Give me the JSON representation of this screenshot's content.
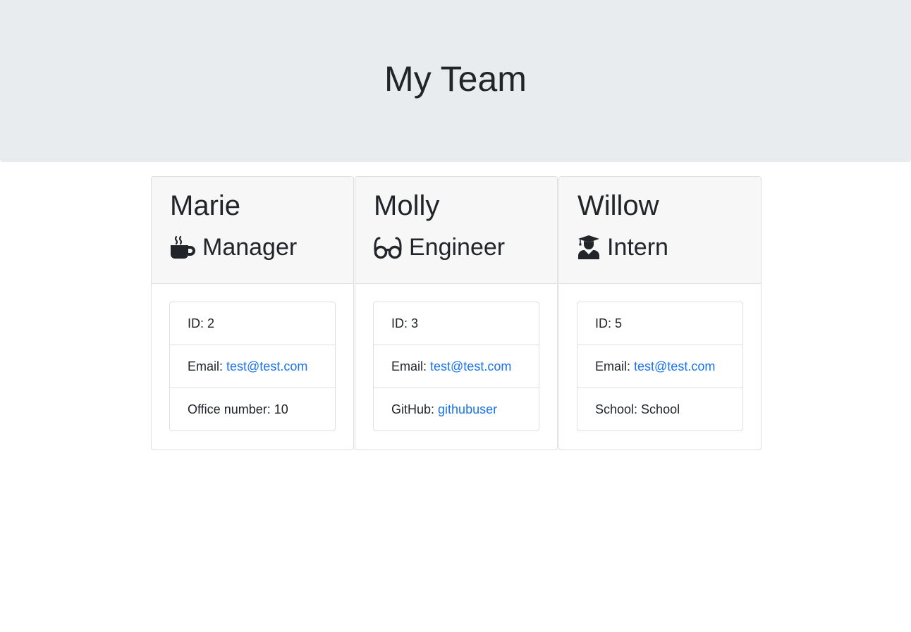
{
  "header": {
    "title": "My Team"
  },
  "team": [
    {
      "name": "Marie",
      "role": "Manager",
      "role_icon": "coffee-mug-icon",
      "id_label": "ID:",
      "id": "2",
      "email_label": "Email:",
      "email": "test@test.com",
      "extra_label": "Office number:",
      "extra_value": "10"
    },
    {
      "name": "Molly",
      "role": "Engineer",
      "role_icon": "glasses-icon",
      "id_label": "ID:",
      "id": "3",
      "email_label": "Email:",
      "email": "test@test.com",
      "extra_label": "GitHub:",
      "extra_value": "githubuser"
    },
    {
      "name": "Willow",
      "role": "Intern",
      "role_icon": "graduate-icon",
      "id_label": "ID:",
      "id": "5",
      "email_label": "Email:",
      "email": "test@test.com",
      "extra_label": "School:",
      "extra_value": "School"
    }
  ],
  "colors": {
    "jumbotron_bg": "#e9ecef",
    "card_header_bg": "#f7f7f7",
    "link": "#1a73e8",
    "text": "#212529"
  }
}
